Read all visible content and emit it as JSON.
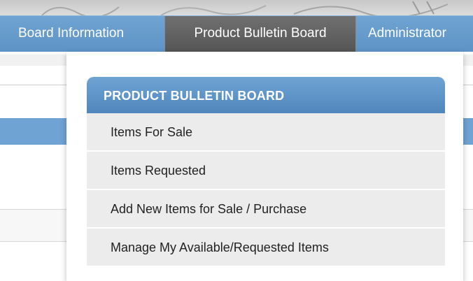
{
  "nav": {
    "tabs": [
      {
        "label": "Board Information",
        "active": false
      },
      {
        "label": "Product Bulletin Board",
        "active": true
      },
      {
        "label": "Administrator",
        "active": false
      }
    ]
  },
  "dropdown": {
    "header": "PRODUCT BULLETIN BOARD",
    "items": [
      {
        "label": "Items For Sale"
      },
      {
        "label": "Items Requested"
      },
      {
        "label": "Add New Items for Sale / Purchase"
      },
      {
        "label": "Manage My Available/Requested Items"
      }
    ]
  },
  "colors": {
    "nav_blue": "#6fa3d2",
    "active_tab": "#5f5f5f",
    "menu_header": "#5f95c8",
    "menu_item_bg": "#ececec"
  }
}
